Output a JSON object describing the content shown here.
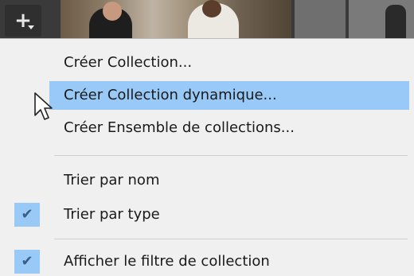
{
  "toolbar": {
    "add_icon": "plus-with-dropdown-icon",
    "add_glyph": "+"
  },
  "menu": {
    "items": [
      {
        "label": "Créer Collection...",
        "checked": false,
        "hover": false
      },
      {
        "label": "Créer Collection dynamique...",
        "checked": false,
        "hover": true
      },
      {
        "label": "Créer Ensemble de collections...",
        "checked": false,
        "hover": false
      },
      {
        "label": "Trier par nom",
        "checked": false,
        "hover": false
      },
      {
        "label": "Trier par type",
        "checked": true,
        "hover": false
      },
      {
        "label": "Afficher le filtre de collection",
        "checked": true,
        "hover": false
      }
    ],
    "check_glyph": "✔"
  },
  "colors": {
    "highlight": "#99c9f7",
    "menu_bg": "#f0f0f0",
    "text": "#1a1a1a",
    "check": "#3a5e86"
  }
}
